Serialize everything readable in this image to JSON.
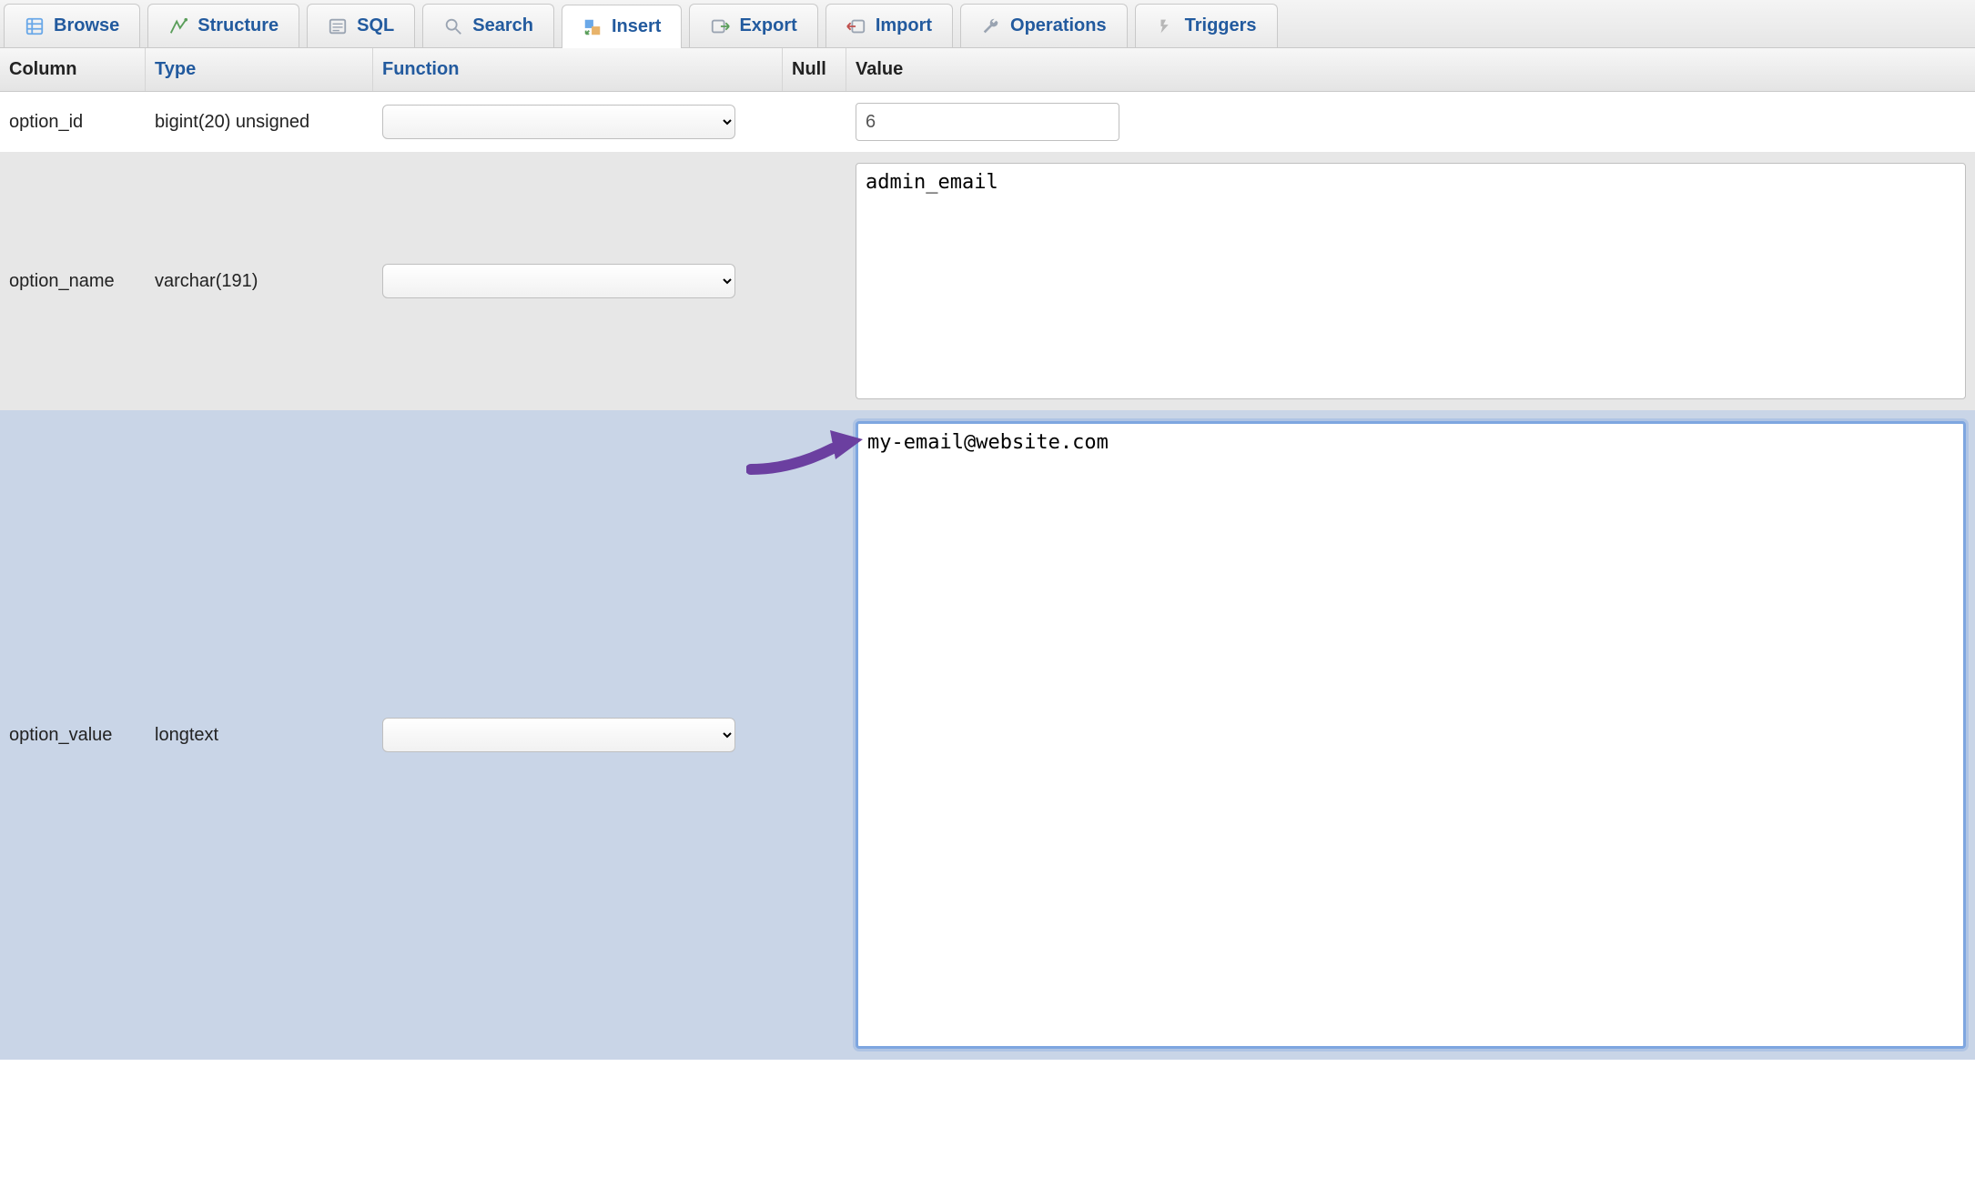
{
  "tabs": [
    {
      "id": "browse",
      "label": "Browse",
      "active": false
    },
    {
      "id": "structure",
      "label": "Structure",
      "active": false
    },
    {
      "id": "sql",
      "label": "SQL",
      "active": false
    },
    {
      "id": "search",
      "label": "Search",
      "active": false
    },
    {
      "id": "insert",
      "label": "Insert",
      "active": true
    },
    {
      "id": "export",
      "label": "Export",
      "active": false
    },
    {
      "id": "import",
      "label": "Import",
      "active": false
    },
    {
      "id": "operations",
      "label": "Operations",
      "active": false
    },
    {
      "id": "triggers",
      "label": "Triggers",
      "active": false
    }
  ],
  "headers": {
    "column": "Column",
    "type": "Type",
    "function": "Function",
    "null": "Null",
    "value": "Value"
  },
  "rows": [
    {
      "column": "option_id",
      "type": "bigint(20) unsigned",
      "function_selected": "",
      "value": "6",
      "input_kind": "text"
    },
    {
      "column": "option_name",
      "type": "varchar(191)",
      "function_selected": "",
      "value": "admin_email",
      "input_kind": "textarea-small"
    },
    {
      "column": "option_value",
      "type": "longtext",
      "function_selected": "",
      "value": "my-email@website.com",
      "input_kind": "textarea-large-focused"
    }
  ],
  "colors": {
    "link": "#225a9e",
    "arrow": "#6b3fa0",
    "focus": "#7ea6e0",
    "row_alt": "#e7e7e7",
    "row_sel": "#c9d5e7"
  }
}
